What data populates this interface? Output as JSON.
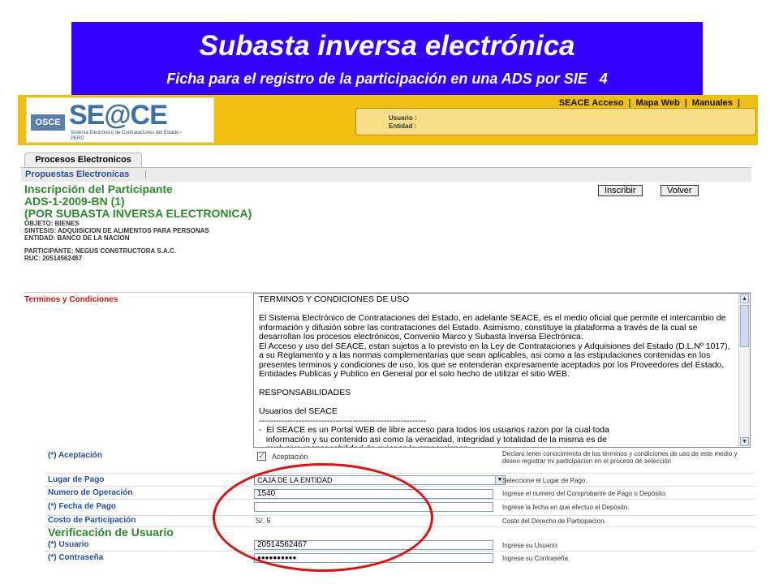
{
  "banner": {
    "title": "Subasta inversa electrónica",
    "subtitle": "Ficha para el registro de la participación en una ADS por SIE",
    "page_number": "4"
  },
  "header": {
    "logo_osce": "OSCE",
    "logo_word": "SE@CE",
    "logo_sub": "Sistema Electrónico de Contrataciones del Estado - PERÚ",
    "links": [
      "SEACE Acceso",
      "Mapa Web",
      "Manuales"
    ],
    "usuario_label": "Usuario :",
    "entidad_label": "Entidad :"
  },
  "tabs": {
    "main": "Procesos Electronicos",
    "sub": "Propuestas Electronicas"
  },
  "process": {
    "heading1": "Inscripción del Participante",
    "heading2": "ADS-1-2009-BN (1)",
    "heading3": "(POR SUBASTA INVERSA ELECTRONICA)",
    "objeto": "OBJETO: BIENES",
    "sintesis": "SINTESIS: ADQUISICION DE ALIMENTOS PARA PERSONAS",
    "entidad": "ENTIDAD: BANCO DE LA NACION",
    "participante": "PARTICIPANTE: NEGUS CONSTRUCTORA S.A.C.",
    "ruc": "RUC: 20514562467"
  },
  "buttons": {
    "inscribir": "Inscribir",
    "volver": "Volver"
  },
  "terms": {
    "label": "Terminos y Condiciones",
    "text": "TERMINOS Y CONDICIONES DE USO\n\nEl Sistema Electrónico de Contrataciones del Estado, en adelante SEACE, es el medio oficial que permite el intercambio de información y difusión sobre las contrataciones del Estado. Asimismo, constituye la plataforma a través de la cual se desarrollan los procesos electrónicos, Convenio Marco y Subasta Inversa Electrónica.\nEl Acceso y uso del SEACE, estan sujetos a lo previsto en la Ley de Contrataciones y Adquisiones del Estado (D.L.Nº 1017), a su Reglamento y a las normas complementarias que sean aplicables, asi como a las estipulaciones contenidas en los presentes terminos y condiciones de uso, los que se entenderan expresamente aceptados por los Proveedores del Estado, Entidades Publicas y Publico en General por el solo hecho de utilizar el sitio WEB.\n\nRESPONSABILIDADES\n\nUsuarios del SEACE\n-----------------------------------------------------------\n-  El SEACE es un Portal WEB de libre acceso para todos los usuarios razon por la cual toda\n   información y su contenido asi como la veracidad, integridad y totalidad de la misma es de\n   exclusiva responsabilidad de quienes la proporcionan."
  },
  "form": {
    "aceptacion_label": "(*) Aceptación",
    "aceptacion_check": "Aceptación",
    "aceptacion_hint": "Declaro tener conocimiento de los términos y condiciones de uso de este medio y deseo registrar mi participacion en el proceso de selección",
    "lugar_label": "Lugar de Pago",
    "lugar_value": "CAJA DE LA ENTIDAD",
    "lugar_hint": "Seleccione el Lugar de Pago.",
    "operacion_label": "Numero de Operación",
    "operacion_value": "1540",
    "operacion_hint": "Ingrese el numero del Comprobante de Pago o Depósito.",
    "fecha_label": "(*) Fecha de Pago",
    "fecha_value": "",
    "fecha_hint": "Ingrese la fecha en que efectuo el Depósito.",
    "costo_label": "Costo de Participación",
    "costo_value": "S/. 5",
    "costo_hint": "Costo del Derecho de Participacion.",
    "verificacion_title": "Verificación de Usuario",
    "usuario_label": "(*) Usuario",
    "usuario_value": "20514562467",
    "usuario_hint": "Ingrese su Usuario.",
    "password_label": "(*) Contraseña",
    "password_value": "●●●●●●●●●●",
    "password_hint": "Ingrese su Contraseña."
  },
  "colors": {
    "banner": "#3300ff",
    "header": "#f0c010",
    "heading_green": "#2b8a2b",
    "label_blue": "#2150a8",
    "terms_red": "#cc1111",
    "annotation_red": "#e01010"
  }
}
